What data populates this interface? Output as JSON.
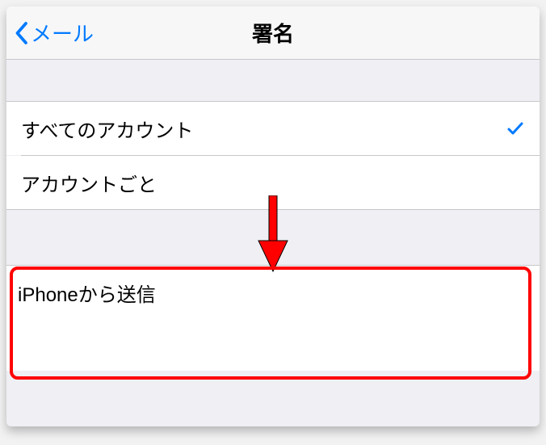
{
  "nav": {
    "back_label": "メール",
    "title": "署名"
  },
  "options": {
    "all_accounts": "すべてのアカウント",
    "per_account": "アカウントごと"
  },
  "signature": {
    "text": "iPhoneから送信"
  },
  "colors": {
    "ios_blue": "#007aff",
    "annotation_red": "#ff0000"
  }
}
